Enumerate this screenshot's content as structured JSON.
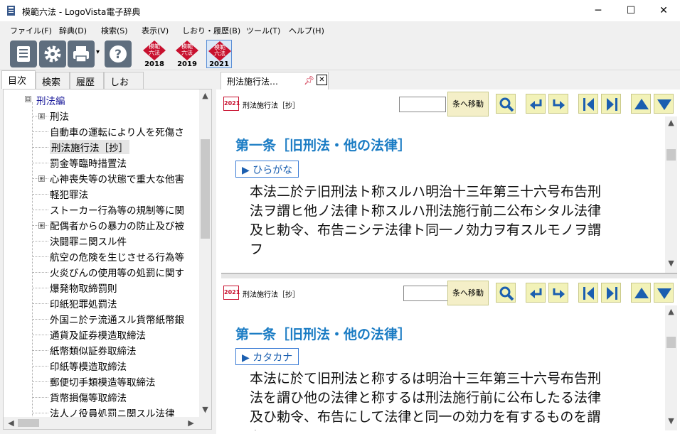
{
  "window": {
    "title": "模範六法 - LogoVista電子辞典",
    "minimize_glyph": "─",
    "maximize_glyph": "☐",
    "close_glyph": "✕"
  },
  "menu": [
    "ファイル(F)",
    "辞典(D)",
    "検索(S)",
    "表示(V)",
    "しおり・履歴(B)",
    "ツール(T)",
    "ヘルプ(H)"
  ],
  "toolbar": {
    "buttons": [
      "dictionary-list-icon",
      "settings-gear-icon",
      "print-icon",
      "help-icon"
    ],
    "dropdown_glyph": "▾",
    "dictionaries": [
      {
        "label_top": "模範",
        "label_mid": "六法",
        "year": "2018"
      },
      {
        "label_top": "模範",
        "label_mid": "六法",
        "year": "2019"
      },
      {
        "label_top": "模範",
        "label_mid": "六法",
        "year": "2021"
      }
    ],
    "accent_red": "#c8102e"
  },
  "left_tabs": [
    "目次",
    "検索",
    "履歴",
    "しおり"
  ],
  "tree": {
    "root": "刑法編",
    "items": [
      {
        "label": "刑法",
        "expandable": true
      },
      {
        "label": "自動車の運転により人を死傷さ",
        "expandable": false
      },
      {
        "label": "刑法施行法［抄］",
        "expandable": false,
        "selected": true
      },
      {
        "label": "罰金等臨時措置法",
        "expandable": false
      },
      {
        "label": "心神喪失等の状態で重大な他害",
        "expandable": true
      },
      {
        "label": "軽犯罪法",
        "expandable": false
      },
      {
        "label": "ストーカー行為等の規制等に関",
        "expandable": false
      },
      {
        "label": "配偶者からの暴力の防止及び被",
        "expandable": true
      },
      {
        "label": "決闘罪ニ関スル件",
        "expandable": false
      },
      {
        "label": "航空の危険を生じさせる行為等",
        "expandable": false
      },
      {
        "label": "火炎びんの使用等の処罰に関す",
        "expandable": false
      },
      {
        "label": "爆発物取締罰則",
        "expandable": false
      },
      {
        "label": "印紙犯罪処罰法",
        "expandable": false
      },
      {
        "label": "外国ニ於テ流通スル貨幣紙幣銀",
        "expandable": false
      },
      {
        "label": "通貨及証券模造取締法",
        "expandable": false
      },
      {
        "label": "紙幣類似証券取締法",
        "expandable": false
      },
      {
        "label": "印紙等模造取締法",
        "expandable": false
      },
      {
        "label": "郵便切手類模造等取締法",
        "expandable": false
      },
      {
        "label": "貨幣損傷等取締法",
        "expandable": false
      },
      {
        "label": "法人ノ役員処罰ニ関スル法律",
        "expandable": false
      }
    ],
    "expand_glyph": "⊞",
    "collapse_glyph": "⊟"
  },
  "doc_tab": {
    "label": "刑法施行法…",
    "close_glyph": "✕"
  },
  "panes": [
    {
      "badge": "2021",
      "doc_title": "刑法施行法［抄］",
      "goto_value": "",
      "goto_label": "条へ移動",
      "heading": "第一条［旧刑法・他の法律］",
      "kana_button": "▶ ひらがな",
      "text_lines": [
        "本法二於テ旧刑法ト称スルハ明治十三年第三十六号布告刑",
        "法ヲ謂ヒ他ノ法律ト称スルハ刑法施行前二公布シタル法律",
        "及ヒ勅令、布告ニシテ法律ト同一ノ効力ヲ有スルモノヲ謂",
        "フ"
      ]
    },
    {
      "badge": "2021",
      "doc_title": "刑法施行法［抄］",
      "goto_value": "",
      "goto_label": "条へ移動",
      "heading": "第一条［旧刑法・他の法律］",
      "kana_button": "▶ カタカナ",
      "text_lines": [
        "本法に於て旧刑法と称するは明治十三年第三十六号布告刑",
        "法を謂ひ他の法律と称するは刑法施行前に公布したる法律",
        "及ひ勅令、布告にして法律と同一の効力を有するものを謂",
        "ふ"
      ]
    }
  ],
  "nav_buttons": [
    "search-icon",
    "back-icon",
    "forward-icon",
    "prev-article-icon",
    "next-article-icon",
    "scroll-up-icon",
    "scroll-down-icon"
  ]
}
